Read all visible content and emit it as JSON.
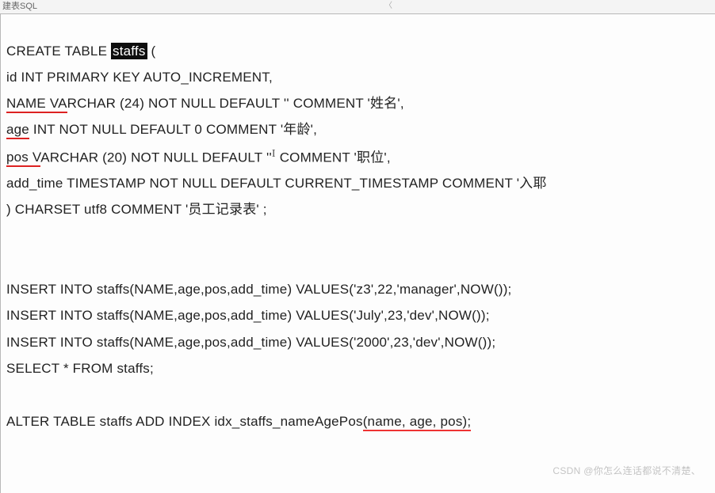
{
  "tab": {
    "label": "建表SQL"
  },
  "scroll_glyph": "〈",
  "sql": {
    "l1_pre": "CREATE TABLE ",
    "l1_hl": "staffs",
    "l1_post": " (",
    "l2": "  id INT PRIMARY KEY AUTO_INCREMENT,",
    "l3_pre": "  ",
    "l3_u": "NAME VA",
    "l3_post": "RCHAR (24) NOT NULL DEFAULT '' COMMENT '姓名',",
    "l4_pre": "  ",
    "l4_u": "age",
    "l4_post": " INT NOT NULL DEFAULT 0 COMMENT '年龄',",
    "l5_pre": "  ",
    "l5_u": "pos V",
    "l5_post1": "ARCHAR (20) NOT NULL DEFAULT ''",
    "l5_post2": " COMMENT '职位',",
    "l6": "  add_time TIMESTAMP NOT NULL DEFAULT CURRENT_TIMESTAMP COMMENT '入耶",
    "l7": ") CHARSET utf8 COMMENT '员工记录表' ;",
    "l8": "INSERT INTO staffs(NAME,age,pos,add_time) VALUES('z3',22,'manager',NOW());",
    "l9": "INSERT INTO staffs(NAME,age,pos,add_time) VALUES('July',23,'dev',NOW());",
    "l10": "INSERT INTO staffs(NAME,age,pos,add_time) VALUES('2000',23,'dev',NOW());",
    "l11": "SELECT * FROM staffs;",
    "l12_pre": "ALTER TABLE staffs ADD INDEX idx_staffs_nameAgePos",
    "l12_u": "(name, age, pos);"
  },
  "watermark": "CSDN @你怎么连话都说不清楚、"
}
